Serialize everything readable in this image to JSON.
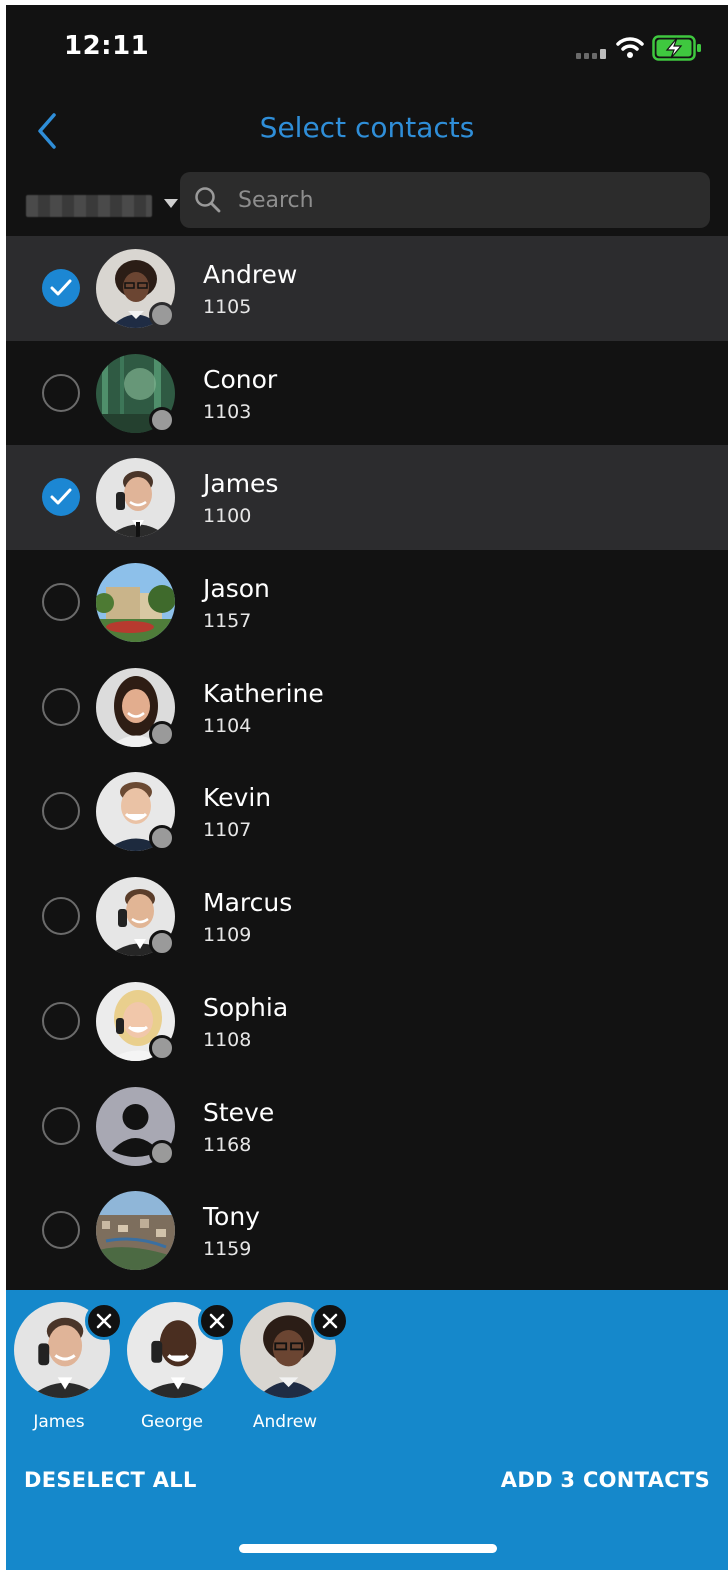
{
  "status_bar": {
    "time": "12:11"
  },
  "header": {
    "title": "Select contacts",
    "back_icon": "chevron-left-icon"
  },
  "filter": {
    "caret_icon": "caret-down-icon"
  },
  "search": {
    "placeholder": "Search",
    "value": ""
  },
  "colors": {
    "accent": "#1c87d3",
    "title": "#2f8ed8",
    "panel": "#1588cb",
    "background": "#121212",
    "selected_row": "#2c2c2e"
  },
  "contacts": [
    {
      "name": "Andrew",
      "ext": "1105",
      "selected": true
    },
    {
      "name": "Conor",
      "ext": "1103",
      "selected": false
    },
    {
      "name": "James",
      "ext": "1100",
      "selected": true
    },
    {
      "name": "Jason",
      "ext": "1157",
      "selected": false
    },
    {
      "name": "Katherine",
      "ext": "1104",
      "selected": false
    },
    {
      "name": "Kevin",
      "ext": "1107",
      "selected": false
    },
    {
      "name": "Marcus",
      "ext": "1109",
      "selected": false
    },
    {
      "name": "Sophia",
      "ext": "1108",
      "selected": false
    },
    {
      "name": "Steve",
      "ext": "1168",
      "selected": false
    },
    {
      "name": "Tony",
      "ext": "1159",
      "selected": false
    }
  ],
  "selection": {
    "chips": [
      {
        "name": "James"
      },
      {
        "name": "George"
      },
      {
        "name": "Andrew"
      }
    ],
    "deselect_label": "DESELECT ALL",
    "add_label": "ADD 3 CONTACTS"
  }
}
